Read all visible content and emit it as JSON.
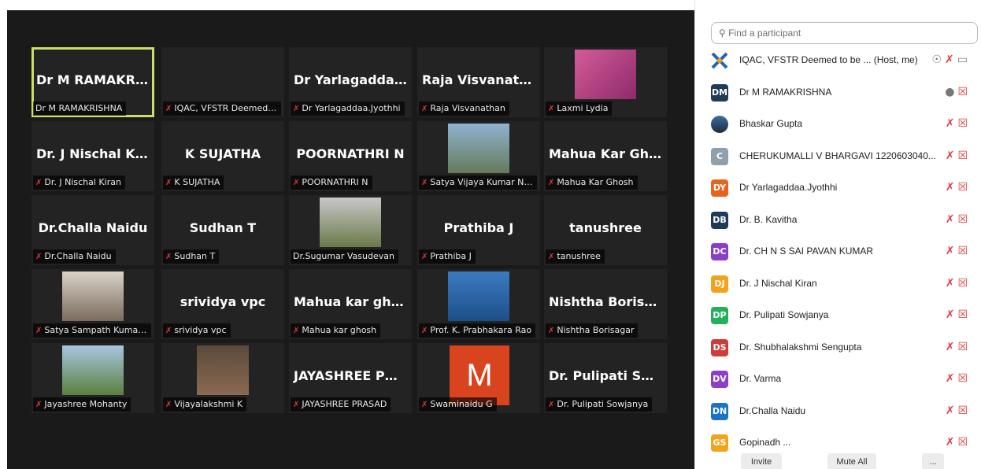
{
  "tiles": [
    {
      "name": "Dr M RAMAKRI...",
      "label": "Dr M RAMAKRISHNA",
      "muted": false,
      "active": true
    },
    {
      "name": "",
      "label": "IQAC, VFSTR Deemed t...",
      "muted": true
    },
    {
      "name": "Dr Yarlagaddaa....",
      "label": "Dr Yarlagaddaa.Jyothhi",
      "muted": true
    },
    {
      "name": "Raja Visvanathan",
      "label": "Raja Visvanathan",
      "muted": true
    },
    {
      "name": "",
      "label": "Laxmi Lydia",
      "muted": true,
      "photo": true
    },
    {
      "name": "Dr. J Nischal Kir...",
      "label": "Dr. J Nischal Kiran",
      "muted": true
    },
    {
      "name": "K SUJATHA",
      "label": "K SUJATHA",
      "muted": true
    },
    {
      "name": "POORNATHRI N",
      "label": "POORNATHRI N",
      "muted": true
    },
    {
      "name": "",
      "label": "Satya Vijaya Kumar Nu...",
      "muted": true,
      "photo": true
    },
    {
      "name": "Mahua Kar Ghosh",
      "label": "Mahua Kar Ghosh",
      "muted": true
    },
    {
      "name": "Dr.Challa Naidu",
      "label": "Dr.Challa Naidu",
      "muted": true
    },
    {
      "name": "Sudhan T",
      "label": "Sudhan T",
      "muted": true
    },
    {
      "name": "",
      "label": "Dr.Sugumar Vasudevan",
      "muted": false,
      "photo": true
    },
    {
      "name": "Prathiba J",
      "label": "Prathiba J",
      "muted": true
    },
    {
      "name": "tanushree",
      "label": "tanushree",
      "muted": true
    },
    {
      "name": "",
      "label": "Satya Sampath Kumar ...",
      "muted": true,
      "photo": true
    },
    {
      "name": "srividya vpc",
      "label": "srividya vpc",
      "muted": true
    },
    {
      "name": "Mahua kar ghosh",
      "label": "Mahua kar ghosh",
      "muted": true
    },
    {
      "name": "",
      "label": "Prof. K. Prabhakara Rao",
      "muted": true,
      "photo": true
    },
    {
      "name": "Nishtha Borisagar",
      "label": "Nishtha Borisagar",
      "muted": true
    },
    {
      "name": "",
      "label": "Jayashree Mohanty",
      "muted": true,
      "photo": true
    },
    {
      "name": "",
      "label": "Vijayalakshmi K",
      "muted": true,
      "photo": true
    },
    {
      "name": "JAYASHREE PR...",
      "label": "JAYASHREE PRASAD",
      "muted": true
    },
    {
      "name": "",
      "label": "Swaminaidu G",
      "muted": true,
      "letter": "M"
    },
    {
      "name": "Dr. Pulipati Sow...",
      "label": "Dr. Pulipati Sowjanya",
      "muted": true
    }
  ],
  "panel": {
    "search_placeholder": "Find a participant",
    "participants": [
      {
        "initials": "",
        "name": "IQAC, VFSTR Deemed to be ... (Host, me)",
        "color": "#ffffff",
        "logo": true
      },
      {
        "initials": "DM",
        "name": "Dr M RAMAKRISHNA",
        "color": "#1f3b57",
        "mic": "on"
      },
      {
        "initials": "",
        "name": "Bhaskar Gupta",
        "color": "#3a6ea5",
        "photo": true
      },
      {
        "initials": "C",
        "name": "CHERUKUMALLI V BHARGAVI 1220603040...",
        "color": "#8fa0ad"
      },
      {
        "initials": "DY",
        "name": "Dr Yarlagaddaa.Jyothhi",
        "color": "#e8641c"
      },
      {
        "initials": "DB",
        "name": "Dr. B. Kavitha",
        "color": "#1f3b57"
      },
      {
        "initials": "DC",
        "name": "Dr. CH N S SAI PAVAN KUMAR",
        "color": "#8b3fc6"
      },
      {
        "initials": "DJ",
        "name": "Dr. J Nischal Kiran",
        "color": "#f2a31c"
      },
      {
        "initials": "DP",
        "name": "Dr. Pulipati Sowjanya",
        "color": "#1fb25a"
      },
      {
        "initials": "DS",
        "name": "Dr. Shubhalakshmi Sengupta",
        "color": "#d13a3a"
      },
      {
        "initials": "DV",
        "name": "Dr. Varma",
        "color": "#8b3fc6"
      },
      {
        "initials": "DN",
        "name": "Dr.Challa Naidu",
        "color": "#1a73c8"
      },
      {
        "initials": "GS",
        "name": "Gopinadh ...",
        "color": "#f2a31c"
      }
    ],
    "footer": {
      "invite": "Invite",
      "mute_all": "Mute All",
      "more": "..."
    }
  }
}
